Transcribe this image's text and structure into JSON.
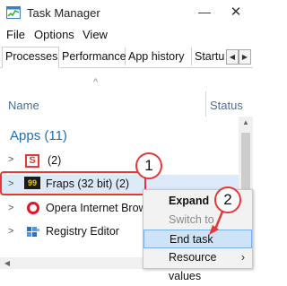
{
  "window": {
    "title": "Task Manager",
    "minimize_glyph": "—",
    "close_glyph": "✕"
  },
  "menu": [
    "File",
    "Options",
    "View"
  ],
  "tabs": [
    "Processes",
    "Performance",
    "App history",
    "Startu"
  ],
  "tab_scroll": {
    "left": "◀",
    "right": "▶"
  },
  "columns": {
    "sort_glyph": "^",
    "name": "Name",
    "status": "Status"
  },
  "group": {
    "label": "Apps (11)"
  },
  "rows": [
    {
      "chevron": ">",
      "label": "(2)",
      "icon": "s-app-icon"
    },
    {
      "chevron": ">",
      "label": "Fraps (32 bit) (2)",
      "icon": "fraps-icon"
    },
    {
      "chevron": ">",
      "label": "Opera Internet Brows",
      "icon": "opera-icon"
    },
    {
      "chevron": ">",
      "label": "Registry Editor",
      "icon": "registry-icon"
    }
  ],
  "context_menu": {
    "items": [
      "Expand",
      "Switch to",
      "End task",
      "Resource values"
    ]
  },
  "badges": [
    "1",
    "2"
  ],
  "colors": {
    "accent": "#1f6fb5",
    "highlight_red": "#e53935",
    "selection": "#dbe9f9"
  }
}
